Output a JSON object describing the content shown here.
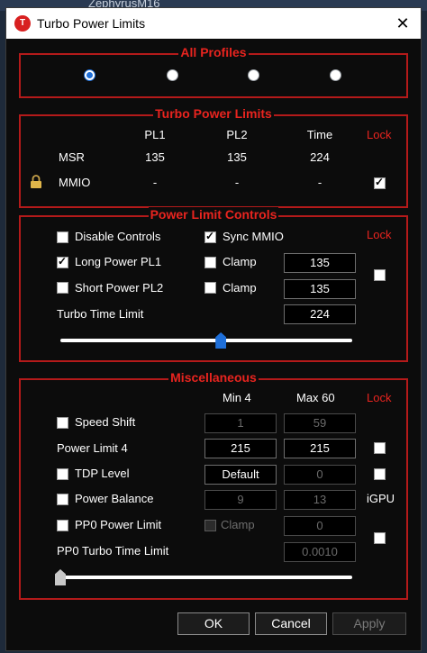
{
  "background": {
    "window_title_partial": "ZephyrusM16"
  },
  "window": {
    "title": "Turbo Power Limits",
    "icon_letter": "T",
    "close_glyph": "✕"
  },
  "all_profiles": {
    "title": "All Profiles",
    "radios": [
      {
        "selected": true
      },
      {
        "selected": false
      },
      {
        "selected": false
      },
      {
        "selected": false
      }
    ]
  },
  "turbo_power_limits": {
    "title": "Turbo Power Limits",
    "headers": {
      "pl1": "PL1",
      "pl2": "PL2",
      "time": "Time",
      "lock": "Lock"
    },
    "rows": [
      {
        "label": "MSR",
        "pl1": "135",
        "pl2": "135",
        "time": "224"
      },
      {
        "label": "MMIO",
        "pl1": "-",
        "pl2": "-",
        "time": "-",
        "lock_checked": true
      }
    ]
  },
  "power_limit_controls": {
    "title": "Power Limit Controls",
    "lock_label": "Lock",
    "disable_controls": {
      "label": "Disable Controls",
      "checked": false
    },
    "sync_mmio": {
      "label": "Sync MMIO",
      "checked": true
    },
    "long_power": {
      "label": "Long Power PL1",
      "checked": true,
      "clamp_label": "Clamp",
      "clamp_checked": false,
      "value": "135"
    },
    "short_power": {
      "label": "Short Power PL2",
      "checked": false,
      "clamp_label": "Clamp",
      "clamp_checked": false,
      "value": "135"
    },
    "turbo_time": {
      "label": "Turbo Time Limit",
      "value": "224",
      "slider_fraction": 0.55
    },
    "lock_checked": false
  },
  "miscellaneous": {
    "title": "Miscellaneous",
    "min_label": "Min  4",
    "max_label": "Max  60",
    "lock_label": "Lock",
    "speed_shift": {
      "label": "Speed Shift",
      "checked": false,
      "min": "1",
      "max": "59"
    },
    "power_limit_4": {
      "label": "Power Limit 4",
      "min": "215",
      "max": "215",
      "lock_checked": false
    },
    "tdp_level": {
      "label": "TDP Level",
      "checked": false,
      "min": "Default",
      "max": "0",
      "lock_checked": false
    },
    "power_balance": {
      "label": "Power Balance",
      "checked": false,
      "min": "9",
      "max": "13",
      "side_label": "iGPU"
    },
    "pp0_power_limit": {
      "label": "PP0 Power Limit",
      "checked": false,
      "clamp_label": "Clamp",
      "value": "0",
      "lock_checked": false
    },
    "pp0_turbo_time": {
      "label": "PP0 Turbo Time Limit",
      "value": "0.0010",
      "slider_fraction": 0.0
    }
  },
  "buttons": {
    "ok": "OK",
    "cancel": "Cancel",
    "apply": "Apply"
  }
}
